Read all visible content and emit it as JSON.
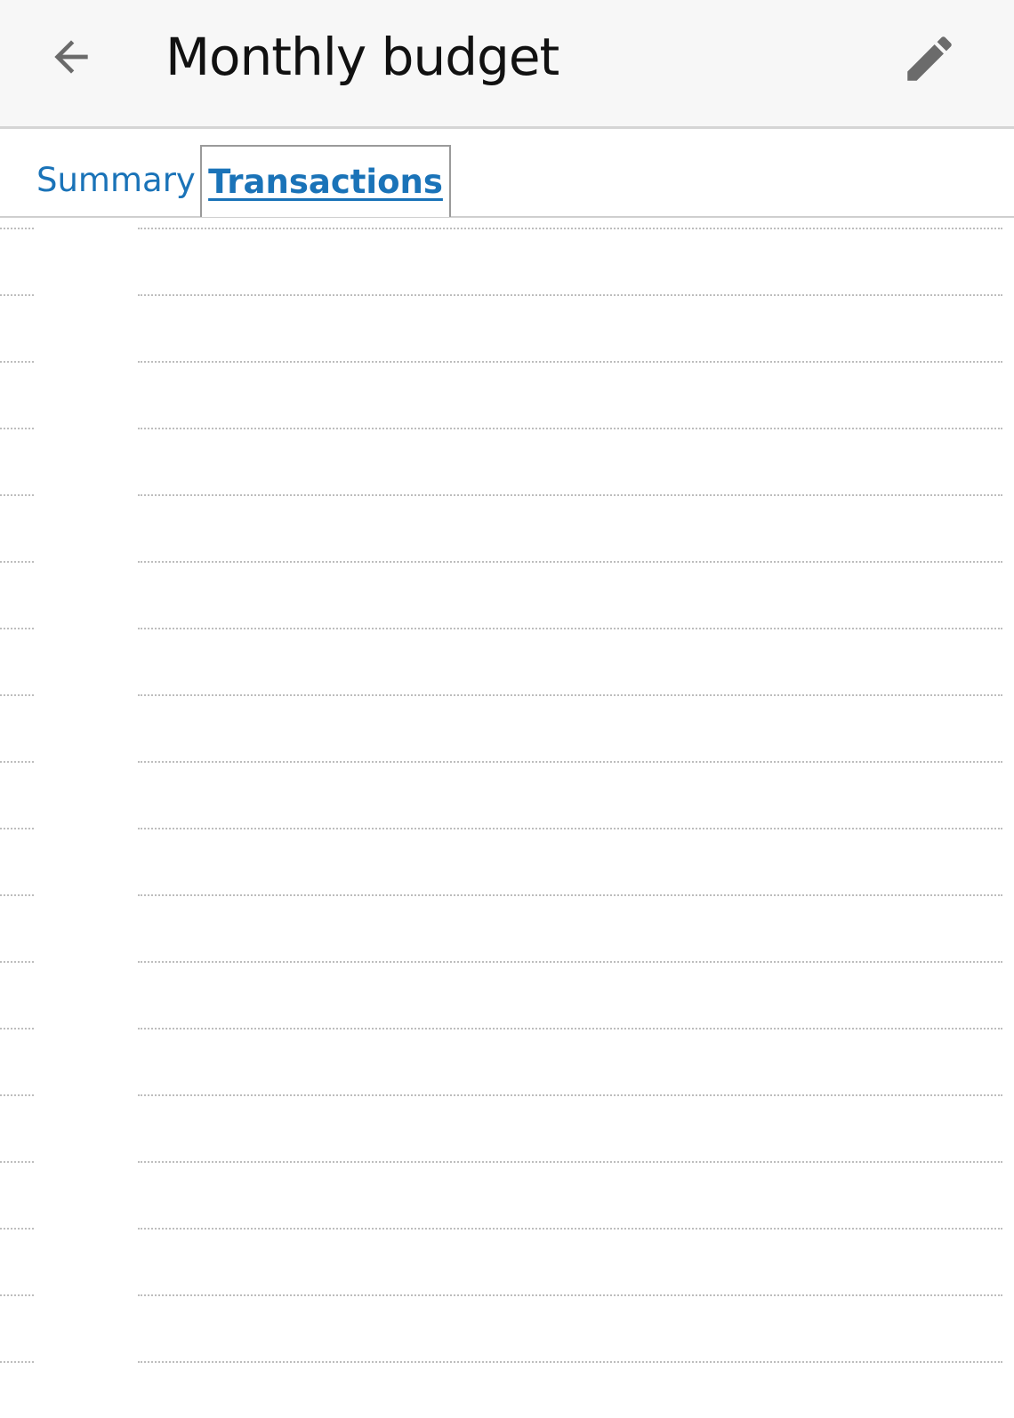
{
  "appbar": {
    "title": "Monthly budget",
    "back_icon": "arrow-back-icon",
    "edit_icon": "pencil-icon"
  },
  "tabs": [
    {
      "label": "Summary",
      "selected": false
    },
    {
      "label": "Transactions",
      "selected": true
    }
  ],
  "colors": {
    "accent": "#1a73b8",
    "appbar_bg": "#f7f7f7",
    "icon": "#6b6b6b",
    "divider": "#bdbdbd"
  },
  "transactions": {
    "row_count": 18,
    "rows_empty": true
  }
}
